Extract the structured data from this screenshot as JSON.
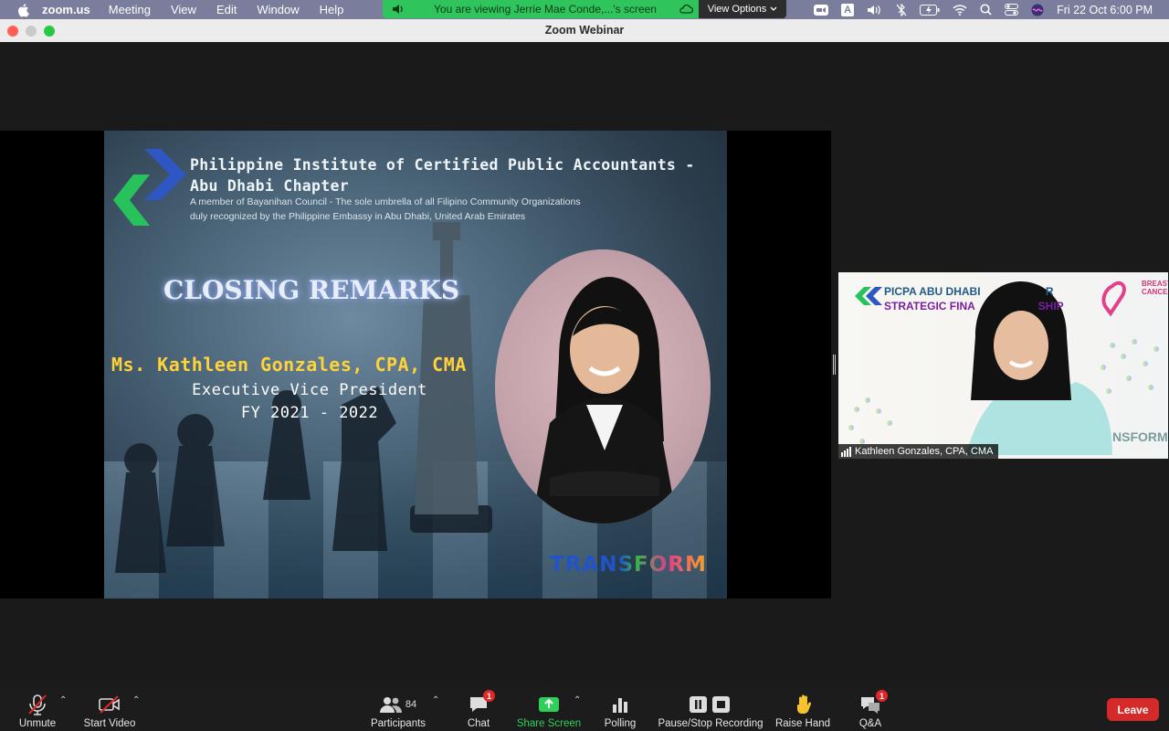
{
  "menubar": {
    "app_name": "zoom.us",
    "items": [
      "Meeting",
      "View",
      "Edit",
      "Window",
      "Help"
    ],
    "share_banner": "You are viewing Jerrie Mae Conde,...'s screen",
    "view_options": "View Options",
    "clock": "Fri 22 Oct  6:00 PM",
    "input_source": "A"
  },
  "window": {
    "title": "Zoom Webinar"
  },
  "slide": {
    "org_line1": "Philippine Institute of Certified Public Accountants -",
    "org_line2": "Abu Dhabi Chapter",
    "sub_line1": "A member of Bayanihan Council - The sole umbrella of all Filipino Community Organizations",
    "sub_line2": "duly recognized by the  Philippine Embassy in Abu Dhabi, United Arab Emirates",
    "heading": "CLOSING REMARKS",
    "speaker_name": "Ms. Kathleen Gonzales, CPA, CMA",
    "speaker_role": "Executive Vice President",
    "speaker_term": "FY 2021 - 2022",
    "brand_logo": "TRANSFORM"
  },
  "speaker_tile": {
    "banner_line1": "PICPA ABU DHABI",
    "banner_line1_end": "R",
    "banner_line2": "STRATEGIC FINA",
    "banner_line2_end": "SHIP",
    "awareness": [
      "BREAST",
      "CANCER"
    ],
    "brand_fragment": "NSFORM",
    "name_label": "Kathleen Gonzales, CPA, CMA"
  },
  "toolbar": {
    "unmute": "Unmute",
    "start_video": "Start Video",
    "participants": "Participants",
    "participants_count": "84",
    "chat": "Chat",
    "chat_badge": "1",
    "share_screen": "Share Screen",
    "polling": "Polling",
    "recording": "Pause/Stop Recording",
    "raise_hand": "Raise Hand",
    "qa": "Q&A",
    "qa_badge": "1",
    "leave": "Leave"
  },
  "colors": {
    "menubar": "#7b7d9c",
    "share_banner": "#2fc45c",
    "leave": "#d42a2a",
    "share_screen_accent": "#2fd059",
    "slide_name": "#ffd23a"
  }
}
